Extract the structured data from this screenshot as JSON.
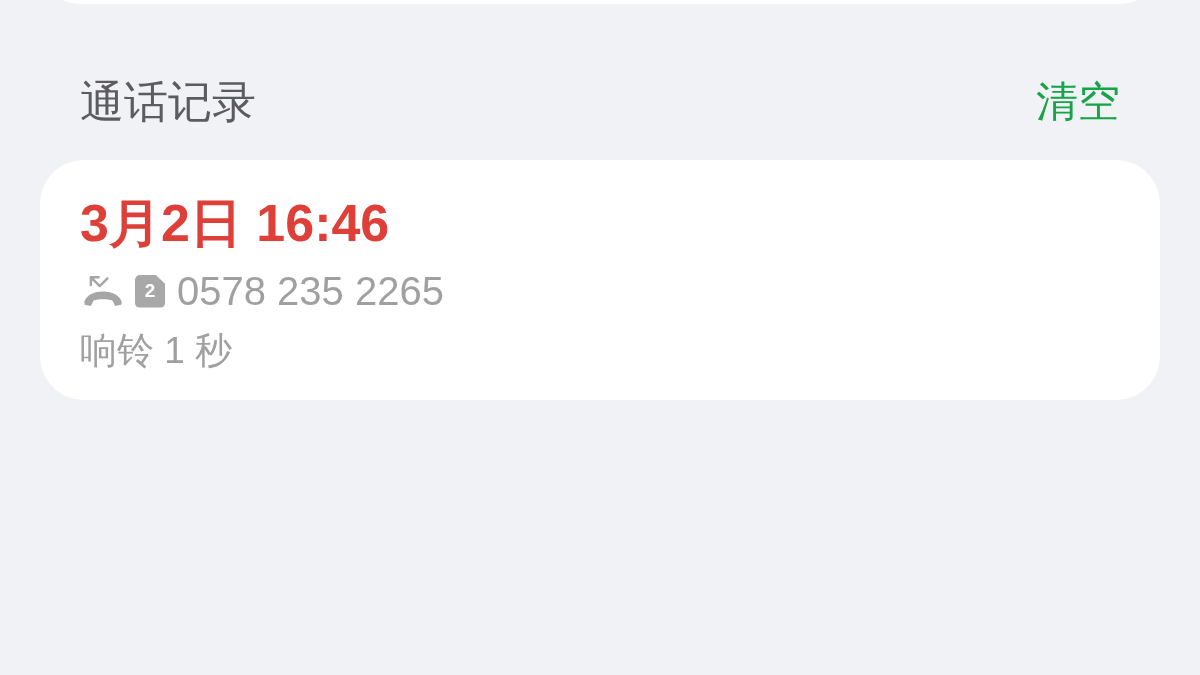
{
  "call_log": {
    "title": "通话记录",
    "clear_button": "清空",
    "entries": [
      {
        "missed": true,
        "time": "3月2日 16:46",
        "sim": "2",
        "number": "0578 235 2265",
        "detail": "响铃 1 秒"
      }
    ]
  }
}
